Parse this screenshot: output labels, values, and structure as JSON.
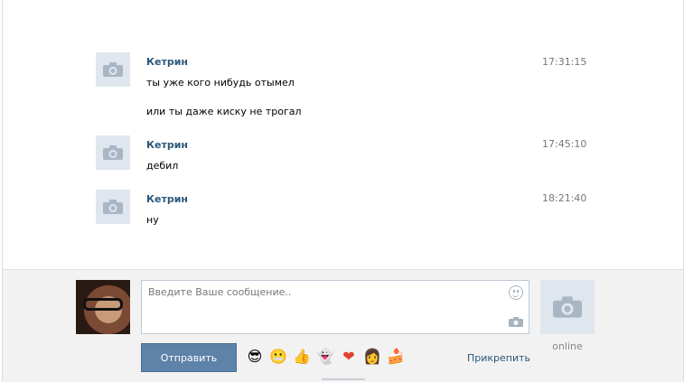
{
  "messages": [
    {
      "author": "Кетрин",
      "time": "17:31:15",
      "lines": [
        "ты уже кого нибудь отымел",
        "или ты даже киску не трогал"
      ]
    },
    {
      "author": "Кетрин",
      "time": "17:45:10",
      "lines": [
        "дебил"
      ]
    },
    {
      "author": "Кетрин",
      "time": "18:21:40",
      "lines": [
        "ну"
      ]
    }
  ],
  "compose": {
    "placeholder": "Введите Ваше сообщение..",
    "send_label": "Отправить",
    "attach_label": "Прикрепить",
    "status": "online"
  },
  "emojis": [
    {
      "name": "sunglasses-emoji",
      "glyph": "😎"
    },
    {
      "name": "grimace-emoji",
      "glyph": "😬"
    },
    {
      "name": "thumbs-up-emoji",
      "glyph": "👍"
    },
    {
      "name": "ghost-emoji",
      "glyph": "👻"
    },
    {
      "name": "heart-emoji",
      "glyph": "❤"
    },
    {
      "name": "nurse-emoji",
      "glyph": "👩"
    },
    {
      "name": "cake-emoji",
      "glyph": "🍰"
    }
  ],
  "colors": {
    "link": "#2b587a",
    "button": "#5e82a8",
    "placeholder_bg": "#dfe6ee"
  }
}
